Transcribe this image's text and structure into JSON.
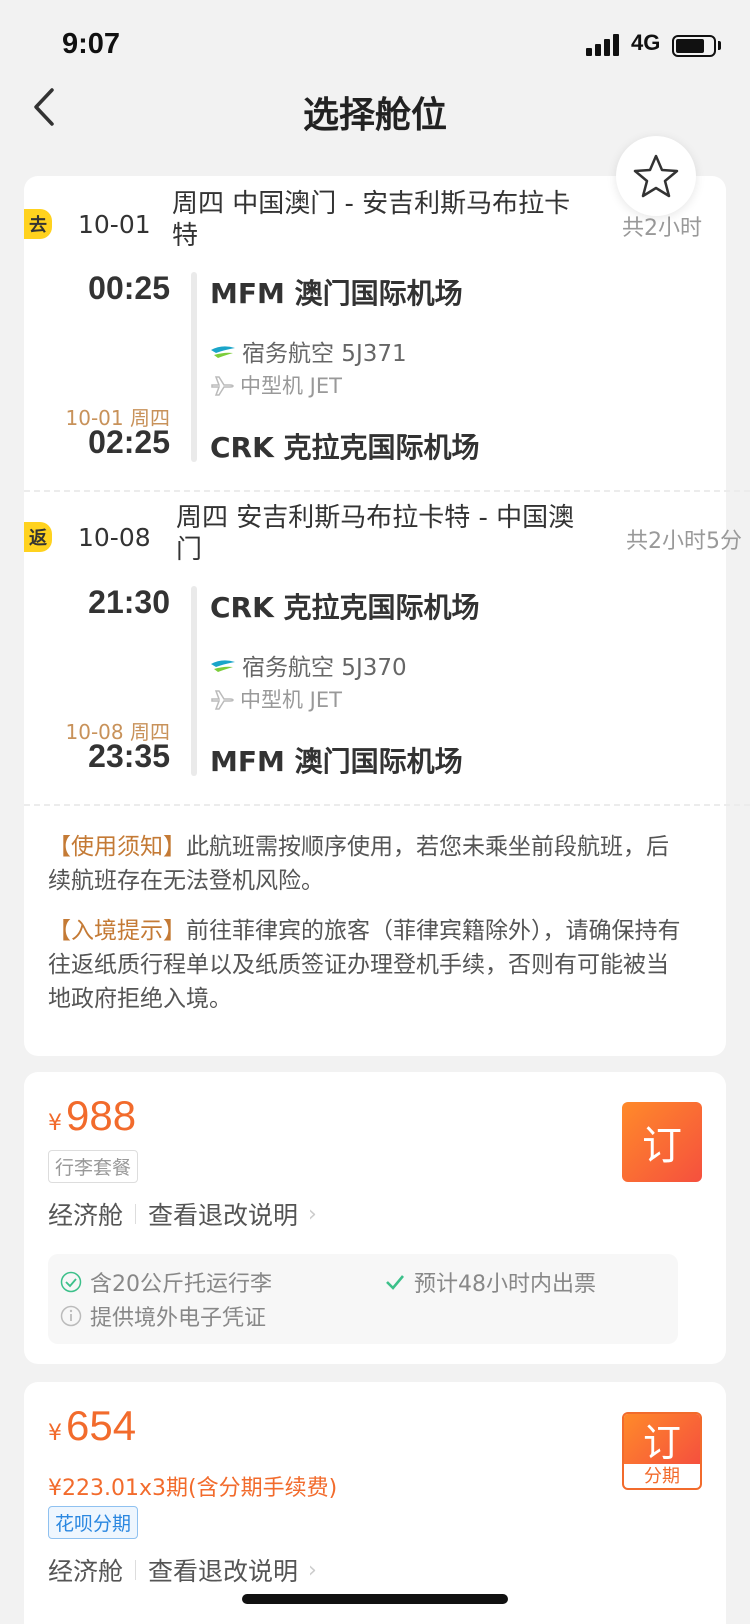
{
  "status_bar": {
    "time": "9:07",
    "network": "4G"
  },
  "nav": {
    "title": "选择舱位"
  },
  "outbound": {
    "tag": "去",
    "date": "10-01",
    "route": "周四 中国澳门 - 安吉利斯马布拉卡特",
    "duration": "共2小时",
    "dep_time": "00:25",
    "dep_airport": "MFM 澳门国际机场",
    "airline": "宿务航空 5J371",
    "aircraft": "中型机 JET",
    "arr_date": "10-01 周四",
    "arr_time": "02:25",
    "arr_airport": "CRK 克拉克国际机场"
  },
  "return": {
    "tag": "返",
    "date": "10-08",
    "route": "周四 安吉利斯马布拉卡特 - 中国澳门",
    "duration": "共2小时5分",
    "dep_time": "21:30",
    "dep_airport": "CRK 克拉克国际机场",
    "airline": "宿务航空 5J370",
    "aircraft": "中型机 JET",
    "arr_date": "10-08 周四",
    "arr_time": "23:35",
    "arr_airport": "MFM 澳门国际机场"
  },
  "notices": [
    {
      "label": "【使用须知】",
      "text": "此航班需按顺序使用，若您未乘坐前段航班，后续航班存在无法登机风险。"
    },
    {
      "label": "【入境提示】",
      "text": "前往菲律宾的旅客（菲律宾籍除外），请确保持有往返纸质行程单以及纸质签证办理登机手续，否则有可能被当地政府拒绝入境。"
    }
  ],
  "offer1": {
    "currency": "¥",
    "price": "988",
    "chip": "行李套餐",
    "cabin": "经济舱",
    "rules_link": "查看退改说明",
    "book_label": "订",
    "features": [
      "含20公斤托运行李",
      "预计48小时内出票",
      "提供境外电子凭证"
    ]
  },
  "offer2": {
    "currency": "¥",
    "price": "654",
    "installment": "¥223.01x3期(含分期手续费)",
    "chip": "花呗分期",
    "cabin": "经济舱",
    "rules_link": "查看退改说明",
    "book_label": "订",
    "book_sub": "分期"
  },
  "colors": {
    "accent": "#f26b2c",
    "tag_yellow": "#ffd21e",
    "date_gold": "#c8925a"
  }
}
